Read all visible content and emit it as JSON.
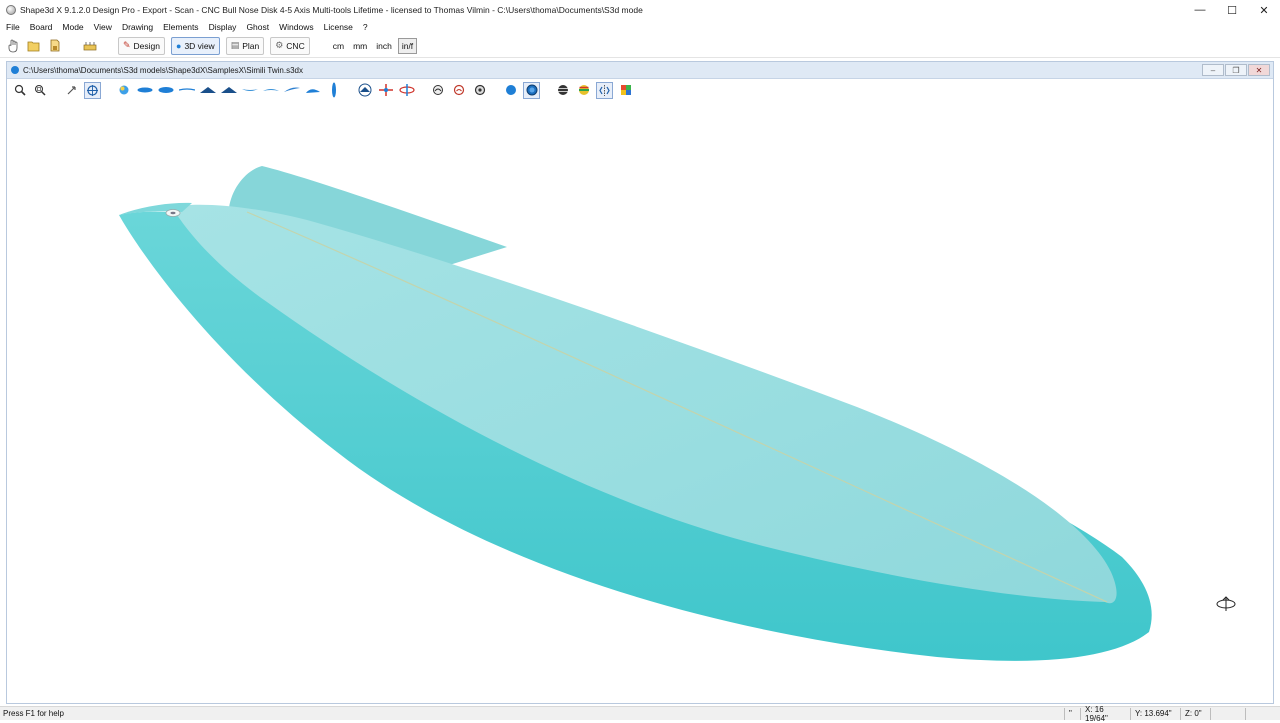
{
  "window": {
    "title": "Shape3d X 9.1.2.0 Design Pro - Export - Scan - CNC Bull Nose Disk 4-5 Axis Multi-tools Lifetime - licensed to Thomas Vilmin - C:\\Users\\thoma\\Documents\\S3d mode",
    "minimize": "—",
    "maximize": "☐",
    "close": "✕"
  },
  "menu": [
    "File",
    "Board",
    "Mode",
    "View",
    "Drawing",
    "Elements",
    "Display",
    "Ghost",
    "Windows",
    "License",
    "?"
  ],
  "toolbar": {
    "modes": [
      {
        "label": "Design",
        "icon": "design-icon",
        "active": false
      },
      {
        "label": "3D view",
        "icon": "3d-view-icon",
        "active": true
      },
      {
        "label": "Plan",
        "icon": "plan-icon",
        "active": false
      },
      {
        "label": "CNC",
        "icon": "cnc-icon",
        "active": false
      }
    ],
    "units": [
      "cm",
      "mm",
      "inch",
      "in/f"
    ],
    "active_unit": "in/f"
  },
  "document": {
    "path": "C:\\Users\\thoma\\Documents\\S3d models\\Shape3dX\\SamplesX\\Simili Twin.s3dx",
    "ctrl_min": "–",
    "ctrl_restore": "❐",
    "ctrl_close": "✕"
  },
  "board": {
    "deck_color": "#97dfe2",
    "rail_color": "#4fcfd3",
    "stringer_color": "#c9d8b2"
  },
  "status": {
    "help": "Press F1 for help",
    "quote": "\"",
    "x": "X: 16 19/64\"",
    "y": "Y: 13.694\"",
    "z": "Z: 0\""
  }
}
